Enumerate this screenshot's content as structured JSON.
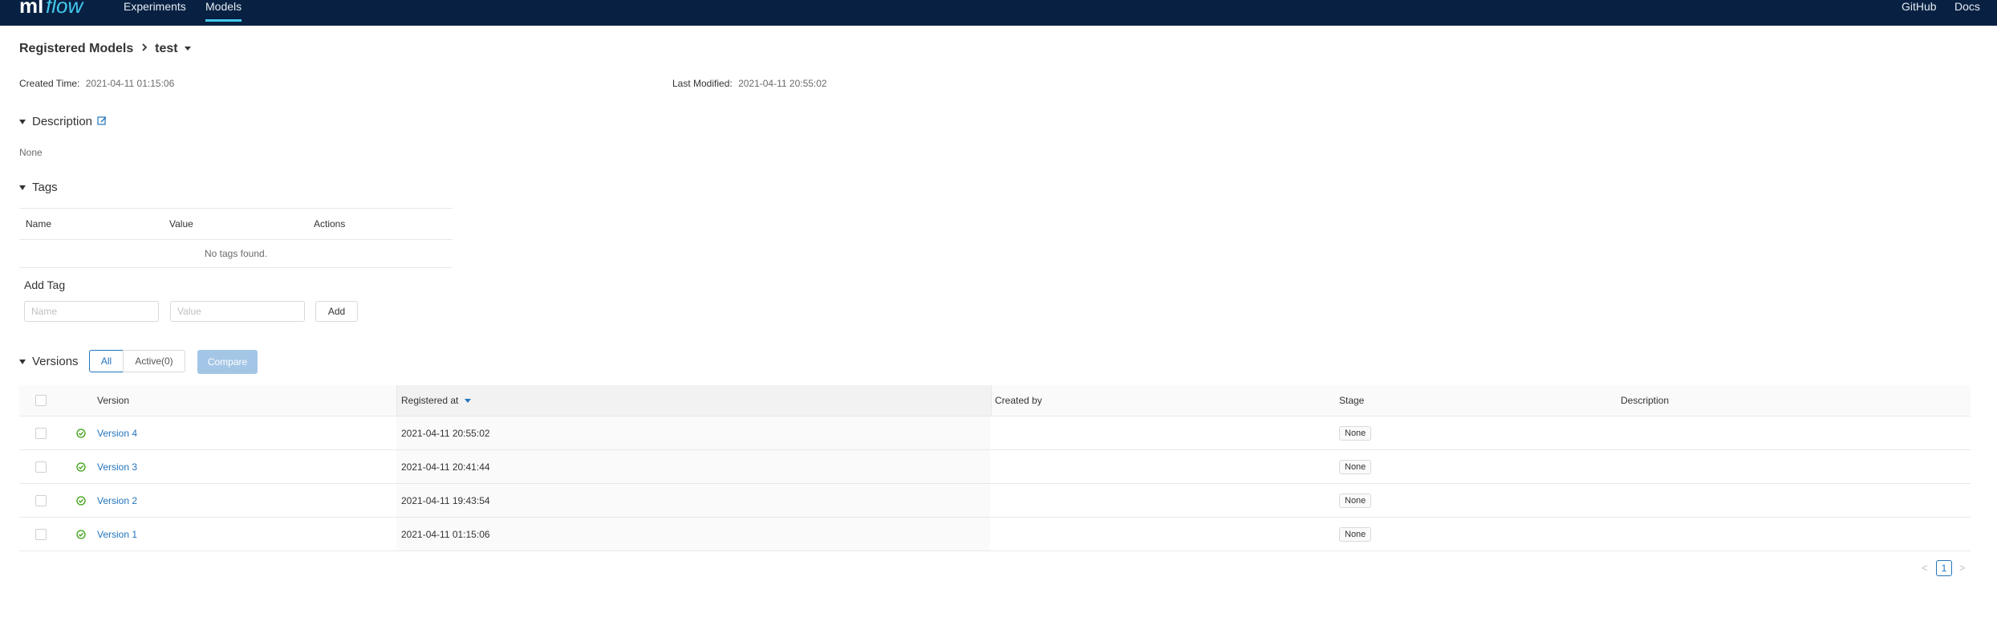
{
  "nav": {
    "logo": "mlflow",
    "items": [
      "Experiments",
      "Models"
    ],
    "right": [
      "GitHub",
      "Docs"
    ]
  },
  "breadcrumb": {
    "parent": "Registered Models",
    "current": "test"
  },
  "meta": {
    "created_label": "Created Time",
    "created_value": "2021-04-11 01:15:06",
    "modified_label": "Last Modified",
    "modified_value": "2021-04-11 20:55:02"
  },
  "description": {
    "title": "Description",
    "value": "None"
  },
  "tags": {
    "title": "Tags",
    "columns": [
      "Name",
      "Value",
      "Actions"
    ],
    "empty": "No tags found.",
    "add_title": "Add Tag",
    "name_placeholder": "Name",
    "value_placeholder": "Value",
    "add_button": "Add"
  },
  "versions": {
    "title": "Versions",
    "filter_all": "All",
    "filter_active": "Active(0)",
    "compare": "Compare",
    "columns": [
      "Version",
      "Registered at",
      "Created by",
      "Stage",
      "Description"
    ],
    "rows": [
      {
        "version": "Version 4",
        "registered": "2021-04-11 20:55:02",
        "created_by": "",
        "stage": "None",
        "description": ""
      },
      {
        "version": "Version 3",
        "registered": "2021-04-11 20:41:44",
        "created_by": "",
        "stage": "None",
        "description": ""
      },
      {
        "version": "Version 2",
        "registered": "2021-04-11 19:43:54",
        "created_by": "",
        "stage": "None",
        "description": ""
      },
      {
        "version": "Version 1",
        "registered": "2021-04-11 01:15:06",
        "created_by": "",
        "stage": "None",
        "description": ""
      }
    ]
  },
  "pagination": {
    "current_page": "1",
    "prev": "<",
    "next": ">"
  },
  "colors": {
    "topbar": "#082143",
    "accent": "#2374bb",
    "active_tab_underline": "#43c9ed",
    "success": "#389e0d"
  }
}
